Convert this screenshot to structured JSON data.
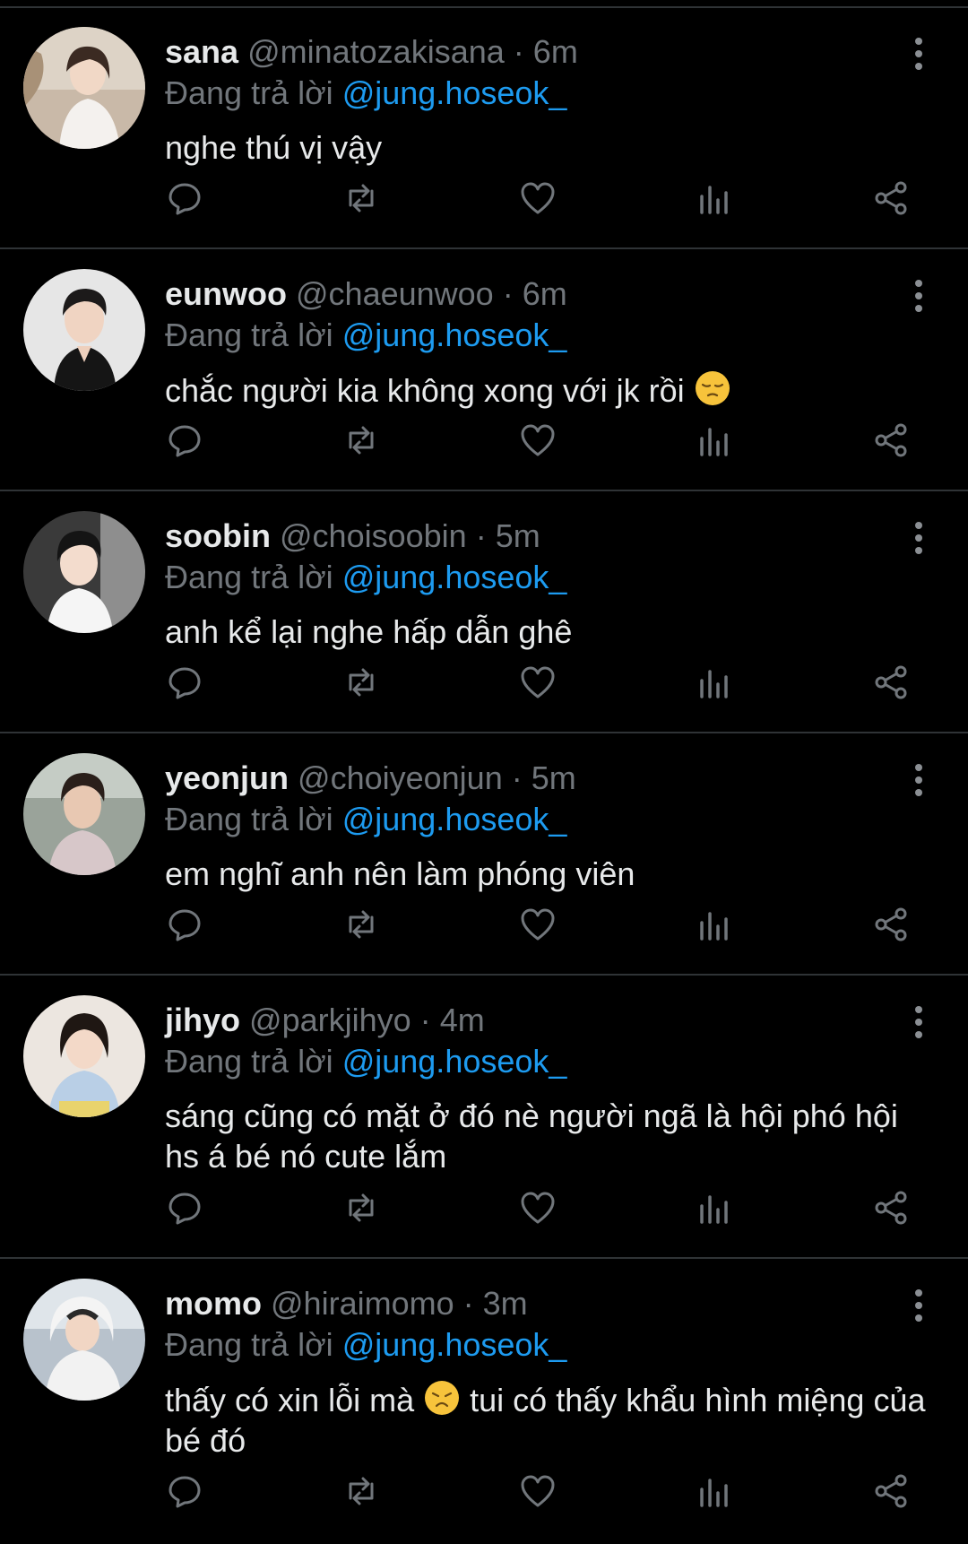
{
  "reply_prefix": "Đang trả lời",
  "colors": {
    "background": "#000000",
    "text": "#e7e9ea",
    "muted": "#71767b",
    "accent": "#1d9bf0",
    "divider": "#2f3336"
  },
  "icons": {
    "reply": "comment-bubble-icon",
    "retweet": "retweet-icon",
    "like": "heart-icon",
    "views": "bar-chart-icon",
    "share": "share-icon",
    "more": "vertical-ellipsis-icon"
  },
  "tweets": [
    {
      "name": "sana",
      "handle": "@minatozakisana",
      "dot": "·",
      "time": "6m",
      "reply_to": "@jung.hoseok_",
      "text": "nghe thú vị vậy"
    },
    {
      "name": "eunwoo",
      "handle": "@chaeunwoo",
      "dot": "·",
      "time": "6m",
      "reply_to": "@jung.hoseok_",
      "text": "chắc người kia không xong với jk rồi",
      "emoji": "pensive-face"
    },
    {
      "name": "soobin",
      "handle": "@choisoobin",
      "dot": "·",
      "time": "5m",
      "reply_to": "@jung.hoseok_",
      "text": "anh kể lại nghe hấp dẫn ghê"
    },
    {
      "name": "yeonjun",
      "handle": "@choiyeonjun",
      "dot": "·",
      "time": "5m",
      "reply_to": "@jung.hoseok_",
      "text": "em nghĩ anh nên làm phóng viên"
    },
    {
      "name": "jihyo",
      "handle": "@parkjihyo",
      "dot": "·",
      "time": "4m",
      "reply_to": "@jung.hoseok_",
      "text": "sáng cũng có mặt ở đó nè người ngã là hội phó hội hs á bé nó cute lắm"
    },
    {
      "name": "momo",
      "handle": "@hiraimomo",
      "dot": "·",
      "time": "3m",
      "reply_to": "@jung.hoseok_",
      "text_before_emoji": "thấy có xin lỗi mà",
      "emoji": "disappointed-face",
      "text_after_emoji": "tui có thấy khẩu hình miệng của bé đó"
    }
  ]
}
